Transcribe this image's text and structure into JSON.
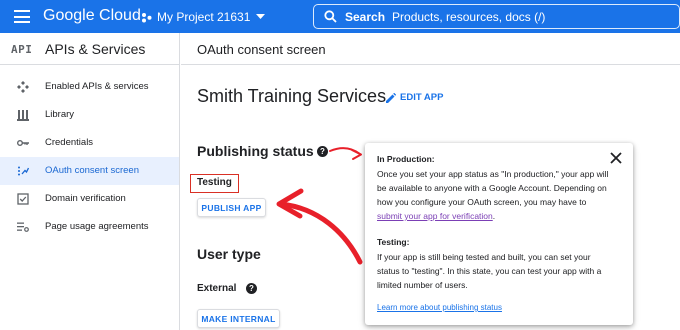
{
  "topbar": {
    "brand": "Google Cloud",
    "project": "My Project 21631",
    "search_label": "Search",
    "search_placeholder": "Products, resources, docs (/)"
  },
  "sidebar": {
    "logo": "API",
    "title": "APIs & Services",
    "items": [
      {
        "label": "Enabled APIs & services",
        "icon": "enabled-apis-icon",
        "active": false
      },
      {
        "label": "Library",
        "icon": "library-icon",
        "active": false
      },
      {
        "label": "Credentials",
        "icon": "key-icon",
        "active": false
      },
      {
        "label": "OAuth consent screen",
        "icon": "consent-icon",
        "active": true
      },
      {
        "label": "Domain verification",
        "icon": "checkbox-icon",
        "active": false
      },
      {
        "label": "Page usage agreements",
        "icon": "settings-list-icon",
        "active": false
      }
    ]
  },
  "main": {
    "header_title": "OAuth consent screen",
    "app_name": "Smith Training Services",
    "edit_app": "EDIT APP",
    "publishing_status": "Publishing status",
    "status_value": "Testing",
    "publish_button": "PUBLISH APP",
    "user_type_heading": "User type",
    "user_type_value": "External",
    "make_internal_button": "MAKE INTERNAL"
  },
  "popup": {
    "prod_heading": "In Production:",
    "prod_text": "Once you set your app status as \"In production,\" your app will be available to anyone with a Google Account. Depending on how you configure your OAuth screen, you may have to ",
    "prod_link": "submit your app for verification",
    "prod_end": ".",
    "testing_heading": "Testing:",
    "testing_text": "If your app is still being tested and built, you can set your status to \"testing\". In this state, you can test your app with a limited number of users.",
    "learn_more": "Learn more about publishing status"
  },
  "colors": {
    "brand_blue": "#1a73e8",
    "annotation_red": "#e8202a",
    "active_nav_bg": "#e8f0fe",
    "link_purple": "#7b3fb5"
  }
}
